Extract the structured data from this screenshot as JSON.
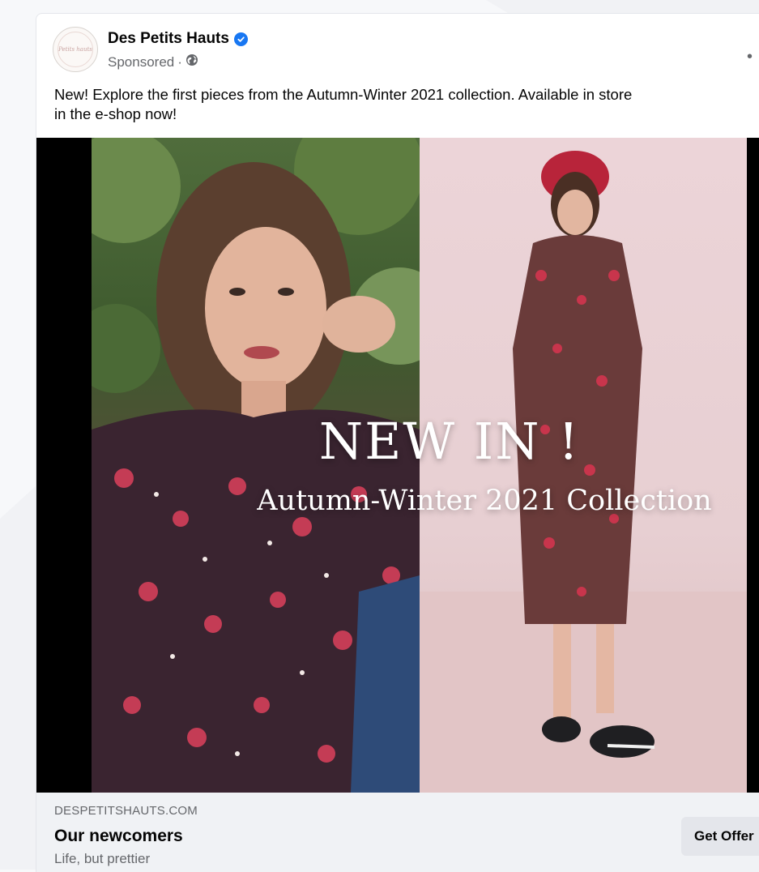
{
  "post": {
    "page_name": "Des Petits Hauts",
    "avatar_text": "Petits hauts",
    "sponsored_label": "Sponsored",
    "separator": "·",
    "privacy_icon": "globe-icon",
    "verified_icon": "verified-badge-icon",
    "more_icon": "more-options-icon",
    "text_line1": "New! Explore the first pieces from the Autumn-Winter 2021 collection. Available in store",
    "text_line2": "in the e-shop now!"
  },
  "media": {
    "overlay_title": "NEW IN !",
    "overlay_subtitle": "Autumn-Winter 2021 Collection"
  },
  "link_preview": {
    "domain": "DESPETITSHAUTS.COM",
    "headline": "Our newcomers",
    "description": "Life, but prettier",
    "cta_label": "Get Offer"
  },
  "colors": {
    "brand_blue": "#1877f2",
    "secondary_text": "#65676b",
    "footer_bg": "#f0f2f5",
    "button_bg": "#e4e6eb"
  }
}
